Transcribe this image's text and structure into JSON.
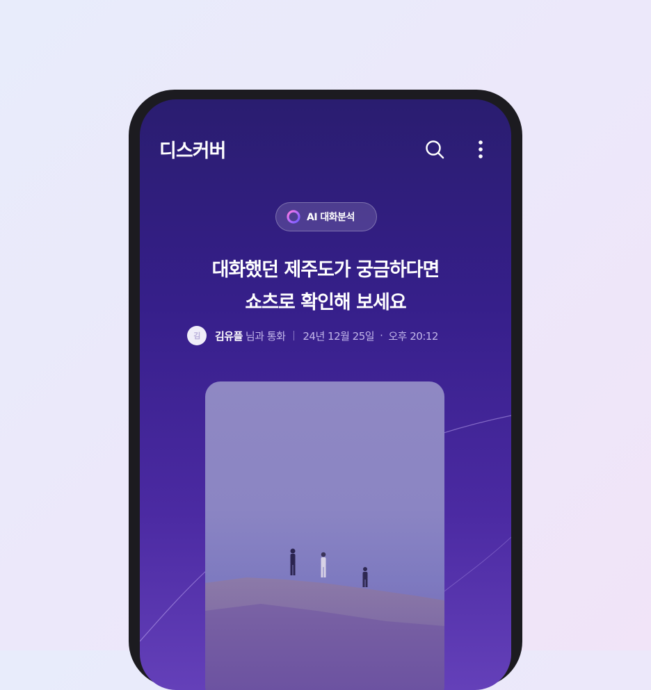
{
  "header": {
    "title": "디스커버",
    "icons": [
      "search-icon",
      "more-vertical-icon"
    ]
  },
  "badge": {
    "icon": "ai-ring-icon",
    "label": "AI 대화분석"
  },
  "headline": {
    "line1": "대화했던 제주도가 궁금하다면",
    "line2": "쇼츠로 확인해 보세요"
  },
  "meta": {
    "avatar_initial": "김",
    "caller_name": "김유플",
    "caller_suffix": "님과 통화",
    "date": "24년 12월 25일",
    "separator_dot": "·",
    "time": "오후 20:12"
  },
  "colors": {
    "screen_top": "#2a1d70",
    "screen_bottom": "#6440b9",
    "phone_frame": "#1c1b20",
    "background": "#ece8fa"
  }
}
